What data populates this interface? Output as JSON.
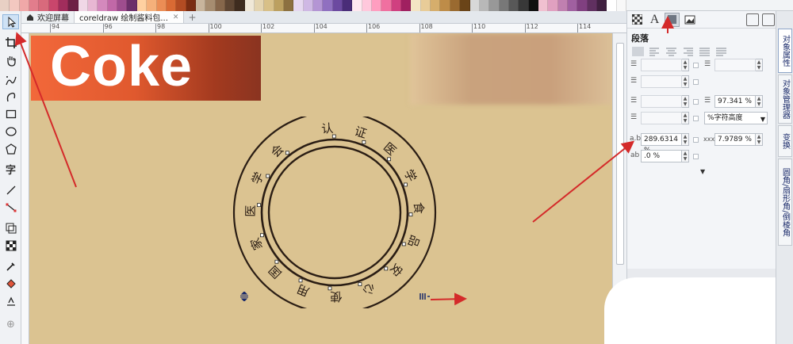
{
  "tabs": [
    {
      "label": "欢迎屏幕"
    },
    {
      "label": "coreldraw 绘制酱料包..."
    }
  ],
  "ruler_h_labels": [
    "94",
    "96",
    "98",
    "100",
    "102",
    "104",
    "106",
    "108",
    "110",
    "112",
    "114"
  ],
  "canvas": {
    "banner_text": "Coke",
    "stamp_chars": [
      "认",
      "证",
      "医",
      "学",
      "食",
      "品",
      "安",
      "心",
      "使",
      "用",
      "国",
      "家",
      "医",
      "学",
      "会"
    ]
  },
  "panel": {
    "section_title": "段落",
    "fields": {
      "line_spacing": "97.341 %",
      "line_spacing_unit": "%字符高度",
      "char_spacing": "289.6314 %",
      "word_spacing": "7.9789 %",
      "lang_spacing": ".0 %"
    }
  },
  "side_tabs": [
    "对象属性",
    "对象管理器",
    "变换",
    "圆角/扇形角/倒棱角"
  ],
  "colors": {
    "canvas": "#dbc391",
    "accent_arrow": "#d42a2a",
    "stamp_ink": "#2a1d14"
  },
  "palette": [
    "#e8d0c4",
    "#f3c8c0",
    "#f0a8a8",
    "#e27d8c",
    "#d86a7c",
    "#c9466c",
    "#a12d5c",
    "#6d1f45",
    "#f0d7e6",
    "#e8b7d3",
    "#d489bd",
    "#c168a7",
    "#9e4d8e",
    "#6c2f6a",
    "#ffd0a0",
    "#f5b07a",
    "#eb8d55",
    "#d96a34",
    "#b34c23",
    "#7a2d12",
    "#c8b59c",
    "#a68d70",
    "#86674b",
    "#5e4633",
    "#3e2c1f",
    "#f0e8d8",
    "#e4d4b0",
    "#d8c088",
    "#bca060",
    "#8c7040",
    "#e6d8f0",
    "#cfb8e4",
    "#b495d4",
    "#9070c0",
    "#6c4aa0",
    "#4a2d78",
    "#ffe8f0",
    "#ffc8dc",
    "#ff9ec0",
    "#f070a0",
    "#d04080",
    "#a02060",
    "#f4e4c4",
    "#e8cc98",
    "#d6ae6c",
    "#be8c48",
    "#9a6a30",
    "#6a4418",
    "#d8d8d8",
    "#b8b8b8",
    "#989898",
    "#787878",
    "#585858",
    "#383838",
    "#101010",
    "#f0c0d0",
    "#e0a0c0",
    "#c080b0",
    "#a060a0",
    "#804080",
    "#603060",
    "#402040",
    "#ffffff",
    "#f8f8f8"
  ]
}
